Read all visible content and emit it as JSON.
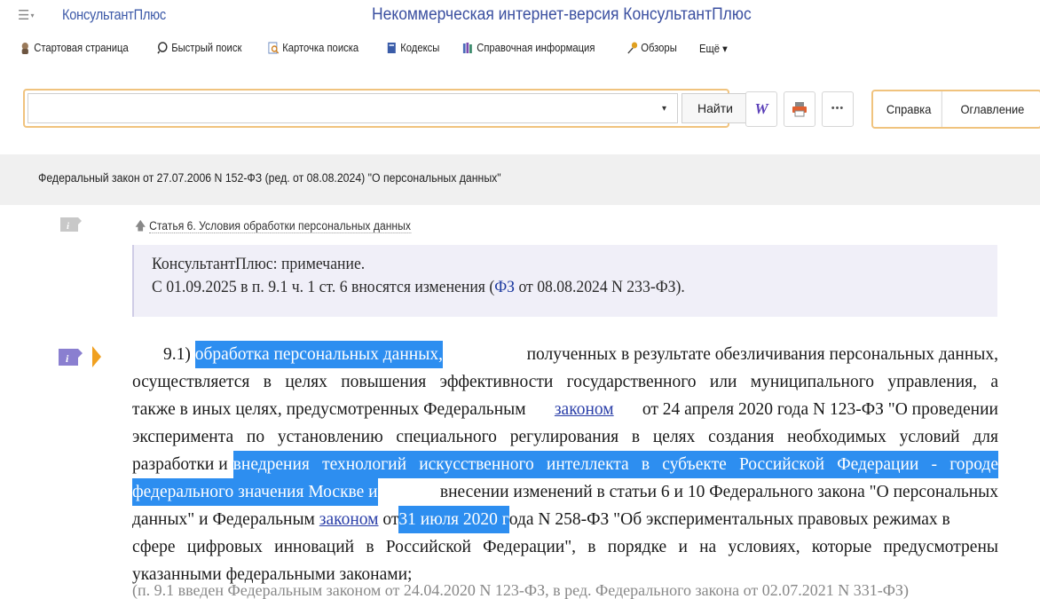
{
  "titlebar": {
    "brand": "КонсультантПлюс",
    "title": "Некоммерческая интернет-версия КонсультантПлюс",
    "menu_caret": "▾"
  },
  "menubar": {
    "items": [
      {
        "label": "Стартовая страница",
        "icon": "home-icon"
      },
      {
        "label": "Быстрый поиск",
        "icon": "search-icon"
      },
      {
        "label": "Карточка поиска",
        "icon": "search-card-icon"
      },
      {
        "label": "Кодексы",
        "icon": "book-icon"
      },
      {
        "label": "Справочная информация",
        "icon": "reference-icon"
      },
      {
        "label": "Обзоры",
        "icon": "pin-icon"
      },
      {
        "label": "Ещё ▾",
        "icon": ""
      }
    ]
  },
  "search": {
    "value": "",
    "dropdown_caret": "▾",
    "find_label": "Найти"
  },
  "tools": {
    "word_label": "W",
    "more_label": "•••"
  },
  "right_tabs": {
    "help": "Справка",
    "toc": "Оглавление"
  },
  "document": {
    "title": "Федеральный закон от 27.07.2006 N 152-ФЗ (ред. от 08.08.2024) \"О персональных данных\"",
    "article_arrow": "🡅",
    "article_link": "Статья 6. Условия обработки персональных данных"
  },
  "note": {
    "line1": "КонсультантПлюс: примечание.",
    "line2_before": "С 01.09.2025 в п. 9.1 ч. 1 ст. 6 вносятся изменения (",
    "line2_link": "ФЗ",
    "line2_after": " от 08.08.2024 N 233-ФЗ)."
  },
  "paragraph": {
    "l1_num": "9.1)",
    "l1_hl": "обработка персональных данных,",
    "l1_rest": "полученных в результате обезличивания персональных данных,",
    "l2": "осуществляется в целях повышения эффективности государственного или муниципального управления, а",
    "l3_a": "также в иных целях, предусмотренных Федеральным",
    "l3_link": "законом",
    "l3_b": "от 24 апреля 2020 года N 123-ФЗ \"О проведении",
    "l4": "эксперимента по установлению специального регулирования в целях создания необходимых условий для",
    "l5_a": "разработки и",
    "l5_hl": "внедрения технологий искусственного интеллекта в субъекте Российской Федерации - городе",
    "l6_hl": "федерального значения Москве и",
    "l6_rest": "внесении изменений в статьи 6 и 10 Федерального закона \"О персональных",
    "l7_a": "данных\" и Федеральным",
    "l7_link": "законом",
    "l7_b": "от",
    "l7_hl": "31 июля 2020 г",
    "l7_c": "ода N 258-ФЗ \"Об экспериментальных правовых режимах в",
    "l8": "сфере цифровых инноваций в Российской Федерации\", в порядке и на условиях, которые предусмотрены",
    "l9": "указанными федеральными законами;",
    "l10_partial": "(п. 9.1 введен Федеральным законом от 24.04.2020 N 123-ФЗ, в ред. Федерального закона от 02.07.2021 N 331-ФЗ)"
  }
}
